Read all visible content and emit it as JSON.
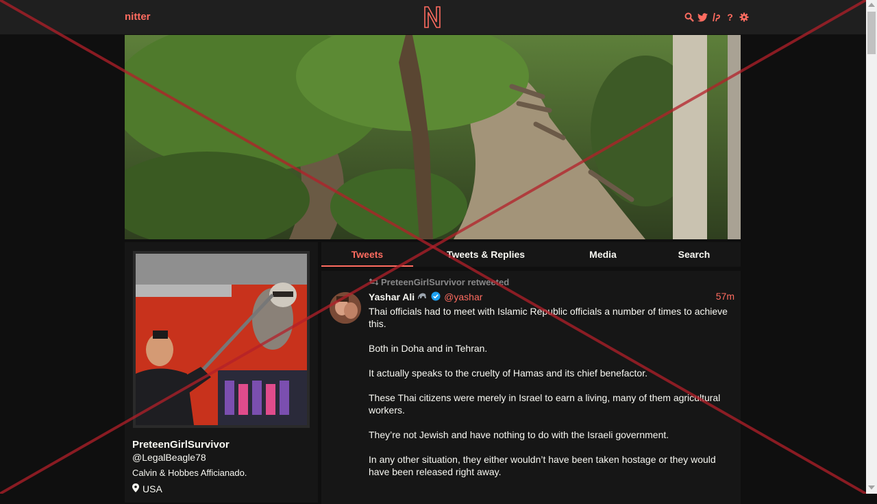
{
  "nav": {
    "brand": "nitter",
    "icons": [
      "search-icon",
      "twitter-bird-icon",
      "lp-icon",
      "help-icon",
      "settings-icon"
    ],
    "help_glyph": "?"
  },
  "profile": {
    "fullname": "PreteenGirlSurvivor",
    "username": "@LegalBeagle78",
    "bio": "Calvin & Hobbes Afficianado.",
    "location": "USA"
  },
  "tabs": [
    {
      "label": "Tweets",
      "active": true
    },
    {
      "label": "Tweets & Replies",
      "active": false
    },
    {
      "label": "Media",
      "active": false
    },
    {
      "label": "Search",
      "active": false
    }
  ],
  "tweet": {
    "retweet_header": "PreteenGirlSurvivor retweeted",
    "fullname": "Yashar Ali",
    "username": "@yashar",
    "date": "57m",
    "paragraphs": [
      "Thai officials had to meet with Islamic Republic officials a number of times to achieve this.",
      "Both in Doha and in Tehran.",
      "It actually speaks to the cruelty of Hamas and its chief benefactor.",
      "These Thai citizens were merely in Israel to earn a living, many of them agricultural workers.",
      "They’re not Jewish and have nothing to do with the Israeli government.",
      "In any other situation, they either wouldn’t have been taken hostage or they would have been released right away."
    ]
  },
  "colors": {
    "accent": "#ff6c60",
    "background": "#0f0f0f",
    "panel": "#161616",
    "navbar": "#1f1f1f",
    "text": "#f8f8f2",
    "muted": "#888889",
    "overlay_x": "#b3202a",
    "verified": "#1da1f2"
  }
}
